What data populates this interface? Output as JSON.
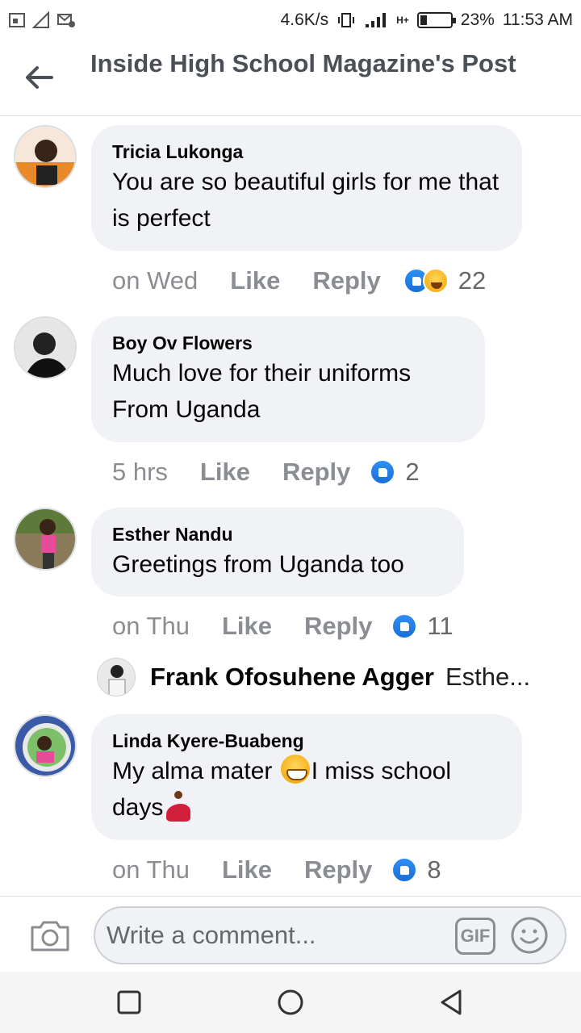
{
  "status_bar": {
    "net_speed": "4.6K/s",
    "network": "H+",
    "battery": "23%",
    "time": "11:53 AM"
  },
  "header": {
    "title": "Inside High School Magazine's Post"
  },
  "comments": [
    {
      "author": "Tricia Lukonga",
      "text": "You are so beautiful girls for me that is perfect",
      "time": "on Wed",
      "like_label": "Like",
      "reply_label": "Reply",
      "reactions": [
        "like-icon",
        "haha-icon"
      ],
      "reaction_count": "22"
    },
    {
      "author": "Boy Ov Flowers",
      "text": "Much love for their uniforms From Uganda",
      "time": "5 hrs",
      "like_label": "Like",
      "reply_label": "Reply",
      "reactions": [
        "like-icon"
      ],
      "reaction_count": "2"
    },
    {
      "author": "Esther Nandu",
      "text": "Greetings from Uganda too",
      "time": "on Thu",
      "like_label": "Like",
      "reply_label": "Reply",
      "reactions": [
        "like-icon"
      ],
      "reaction_count": "11",
      "reply_preview": {
        "author": "Frank Ofosuhene Agger",
        "text": "Esthe..."
      }
    },
    {
      "author": "Linda Kyere-Buabeng",
      "text_part1": "My alma mater ",
      "text_part2": "I miss school days",
      "time": "on Thu",
      "like_label": "Like",
      "reply_label": "Reply",
      "reactions": [
        "like-icon"
      ],
      "reaction_count": "8"
    }
  ],
  "composer": {
    "placeholder": "Write a comment...",
    "gif_label": "GIF"
  },
  "colors": {
    "bubble": "#f0f2f5",
    "like_blue": "#1a77f2",
    "meta_gray": "#8a8d91"
  }
}
